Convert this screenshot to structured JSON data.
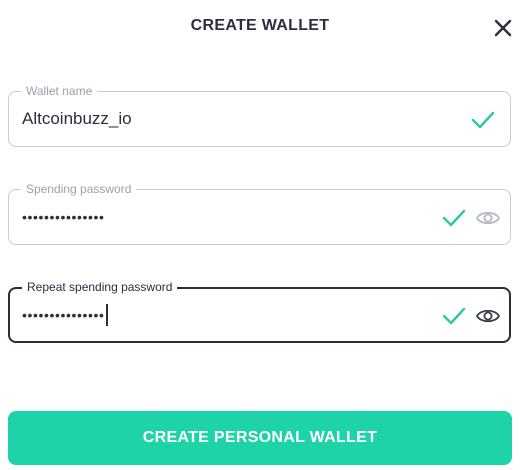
{
  "dialog": {
    "title": "CREATE WALLET",
    "close_icon": "close-icon"
  },
  "fields": {
    "wallet_name": {
      "label": "Wallet name",
      "value": "Altcoinbuzz_io",
      "valid": true
    },
    "spending_password": {
      "label": "Spending password",
      "masked_value": "•••••••••••••••",
      "valid": true,
      "visibility_toggle": "eye-icon"
    },
    "repeat_spending_password": {
      "label": "Repeat spending password",
      "masked_value": "•••••••••••••••",
      "valid": true,
      "focused": true,
      "visibility_toggle": "eye-icon"
    }
  },
  "actions": {
    "create_button_label": "CREATE PERSONAL WALLET"
  },
  "colors": {
    "accent": "#1ed3a8",
    "check": "#2ec7a0",
    "text": "#2b2f3e",
    "label": "#9aa1ad",
    "border": "#c8ccd6",
    "border_active": "#2a2d3a"
  }
}
